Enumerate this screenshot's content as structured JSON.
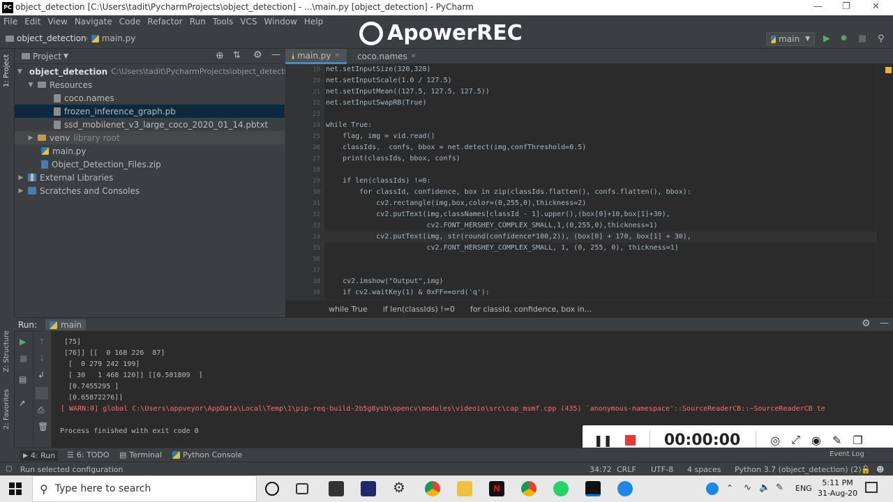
{
  "titlebar": {
    "title": "object_detection [C:\\Users\\tadit\\PycharmProjects\\object_detection] - ...\\main.py [object_detection] - PyCharm",
    "logo": "PC"
  },
  "menu": [
    "File",
    "Edit",
    "View",
    "Navigate",
    "Code",
    "Refactor",
    "Run",
    "Tools",
    "VCS",
    "Window",
    "Help"
  ],
  "navbar": {
    "project": "object_detection",
    "file": "main.py",
    "run_config": "main"
  },
  "watermark": "ApowerREC",
  "project_panel": {
    "title": "Project",
    "tree": [
      {
        "label": "object_detection",
        "path": "C:\\Users\\tadit\\PycharmProjects\\object_detection"
      },
      {
        "label": "Resources"
      },
      {
        "label": "coco.names"
      },
      {
        "label": "frozen_inference_graph.pb"
      },
      {
        "label": "ssd_mobilenet_v3_large_coco_2020_01_14.pbtxt"
      },
      {
        "label": "venv",
        "hint": "library root"
      },
      {
        "label": "main.py"
      },
      {
        "label": "Object_Detection_Files.zip"
      },
      {
        "label": "External Libraries"
      },
      {
        "label": "Scratches and Consoles"
      }
    ]
  },
  "left_strip": {
    "project": "1: Project",
    "structure": "Z: Structure",
    "favorites": "2: Favorites"
  },
  "editor": {
    "tabs": [
      "main.py",
      "coco.names"
    ],
    "line_numbers": [
      "19",
      "20",
      "21",
      "22",
      "23",
      "24",
      "25",
      "26",
      "27",
      "28",
      "29",
      "30",
      "31",
      "32",
      "33",
      "34",
      "35",
      "36",
      "37",
      "38",
      "39"
    ],
    "lines": [
      "net.setInputSize(320,320)",
      "net.setInputScale(1.0 / 127.5)",
      "net.setInputMean((127.5, 127.5, 127.5))",
      "net.setInputSwapRB(True)",
      "",
      "while True:",
      "    flag, img = vid.read()",
      "    classIds,  confs, bbox = net.detect(img,confThreshold=0.5)",
      "    print(classIds, bbox, confs)",
      "",
      "    if len(classIds) !=0:",
      "        for classId, confidence, box in zip(classIds.flatten(), confs.flatten(), bbox):",
      "            cv2.rectangle(img,box,color=(0,255,0),thickness=2)",
      "            cv2.putText(img,classNames[classId - 1].upper(),(box[0]+10,box[1]+30),",
      "                        cv2.FONT_HERSHEY_COMPLEX_SMALL,1,(0,255,0),thickness=1)",
      "            cv2.putText(img, str(round(confidence*100,2)), (box[0] + 170, box[1] + 30),",
      "                        cv2.FONT_HERSHEY_COMPLEX_SMALL, 1, (0, 255, 0), thickness=1)",
      "",
      "",
      "    cv2.imshow(\"Output\",img)",
      "    if cv2.waitKey(1) & 0xFF==ord('q'):"
    ],
    "breadcrumb": [
      "while True",
      "if len(classIds) !=0",
      "for classId, confidence, box in..."
    ]
  },
  "run_panel": {
    "label": "Run:",
    "config": "main",
    "output": [
      "[75]",
      "[76]] [[  0 168 226  87]",
      " [  0 279 242 199]",
      " [ 30   1 468 120]] [[0.501809  ]",
      " [0.7455295 ]",
      " [0.65872276]]"
    ],
    "warning": "[ WARN:0] global C:\\Users\\appveyor\\AppData\\Local\\Temp\\1\\pip-req-build-2b5g8ysb\\opencv\\modules\\videoio\\src\\cap_msmf.cpp (435) `anonymous-namespace'::SourceReaderCB::~SourceReaderCB te",
    "exit": "Process finished with exit code 0"
  },
  "recorder": {
    "time": "00:00:00"
  },
  "tool_tabs": [
    "4: Run",
    "6: TODO",
    "Terminal",
    "Python Console"
  ],
  "event_log": "Event Log",
  "status": {
    "message": "Run selected configuration",
    "position": "34:72",
    "line_sep": "CRLF",
    "encoding": "UTF-8",
    "indent": "4 spaces",
    "interpreter": "Python 3.7 (object_detection) (2)"
  },
  "taskbar": {
    "search_placeholder": "Type here to search",
    "lang": "ENG",
    "time": "5:11 PM",
    "date": "31-Aug-20"
  }
}
